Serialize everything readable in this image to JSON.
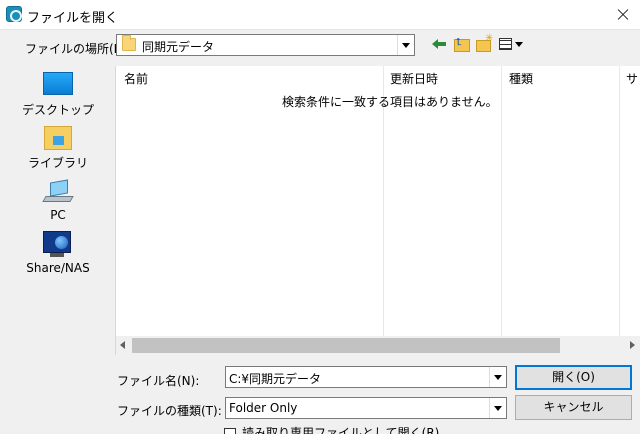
{
  "window": {
    "title": "ファイルを開く"
  },
  "lookin": {
    "label": "ファイルの場所(I):",
    "value": "同期元データ"
  },
  "places": [
    {
      "label": "デスクトップ"
    },
    {
      "label": "ライブラリ"
    },
    {
      "label": "PC"
    },
    {
      "label": "Share/NAS"
    }
  ],
  "filelist": {
    "columns": [
      "名前",
      "更新日時",
      "種類",
      "サ"
    ],
    "empty_message": "検索条件に一致する項目はありません。"
  },
  "filename": {
    "label": "ファイル名(N):",
    "value": "C:¥同期元データ"
  },
  "filetype": {
    "label": "ファイルの種類(T):",
    "value": "Folder Only"
  },
  "buttons": {
    "open": "開く(O)",
    "cancel": "キャンセル"
  },
  "readonly": {
    "label": "読み取り専用ファイルとして開く(R)"
  }
}
